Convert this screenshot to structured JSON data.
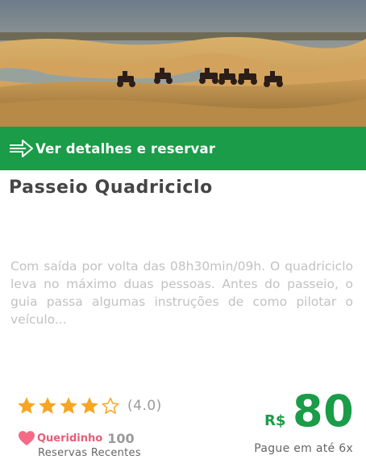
{
  "hero": {
    "image_description_icon": "desert-dunes-atv-photo"
  },
  "cta": {
    "label": "Ver detalhes e reservar",
    "icon": "arrow-right-icon",
    "color": "#1a9c48"
  },
  "tour": {
    "title": "Passeio Quadriciclo",
    "description": "Com saída por volta das 08h30min/09h. O quadriciclo leva no máximo duas pessoas. Antes do passeio, o guia passa algumas instruções de como pilotar o veículo..."
  },
  "rating": {
    "stars_filled": 4,
    "stars_total": 5,
    "value_label": "(4.0)",
    "star_color": "#f6a623"
  },
  "favorite": {
    "label": "Queridinho",
    "count": "100",
    "bookings_label": "Reservas Recentes",
    "heart_color": "#f36b86"
  },
  "price": {
    "currency": "R$",
    "amount": "80",
    "installments": "Pague em até 6x",
    "color": "#1a9c48"
  }
}
